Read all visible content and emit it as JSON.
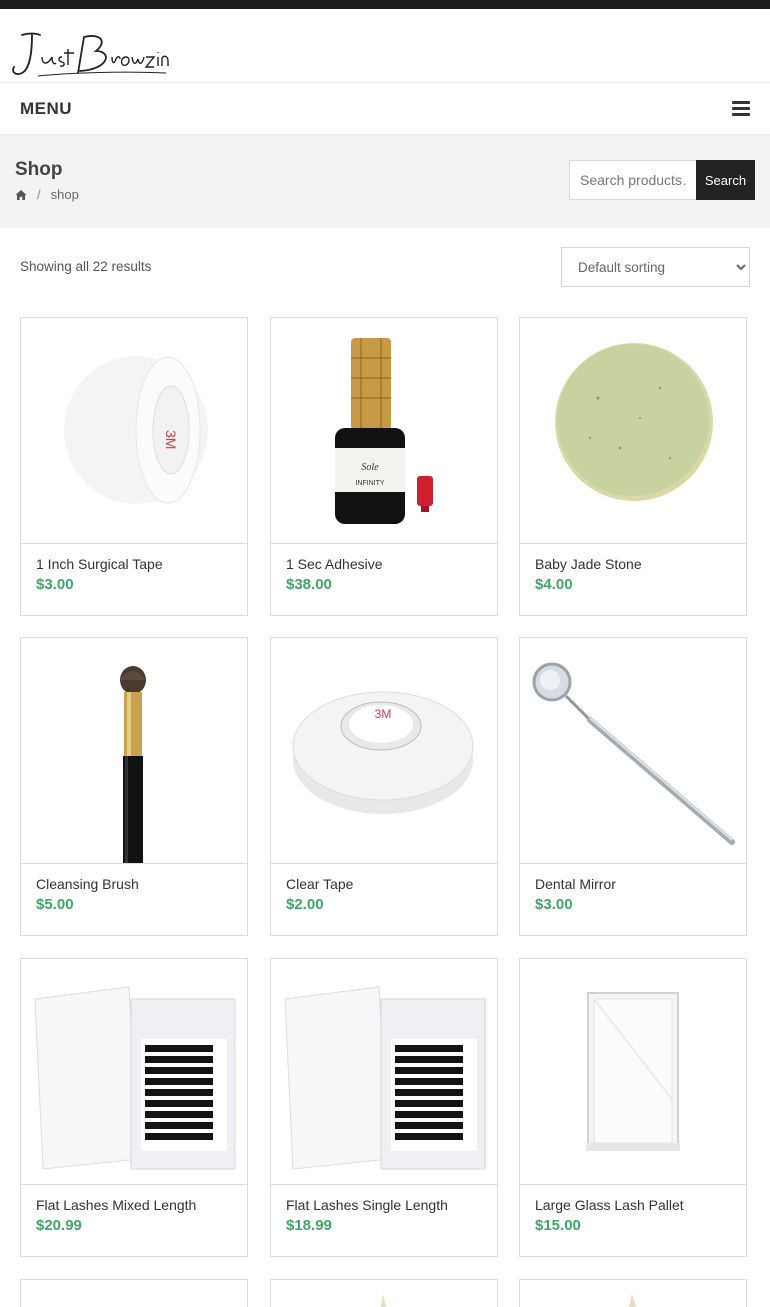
{
  "brand": {
    "logo_text": "Just Browzin"
  },
  "menu": {
    "label": "MENU"
  },
  "page": {
    "title": "Shop",
    "breadcrumb": [
      "shop"
    ]
  },
  "search": {
    "placeholder": "Search products…",
    "button_label": "Search"
  },
  "catalog": {
    "results_text": "Showing all 22 results",
    "sort_selected": "Default sorting",
    "products": [
      {
        "name": "1 Inch Surgical Tape",
        "price": "$3.00",
        "image": "surgical-tape-image"
      },
      {
        "name": "1 Sec Adhesive",
        "price": "$38.00",
        "image": "adhesive-bottle-image"
      },
      {
        "name": "Baby Jade Stone",
        "price": "$4.00",
        "image": "jade-stone-image"
      },
      {
        "name": "Cleansing Brush",
        "price": "$5.00",
        "image": "cleansing-brush-image"
      },
      {
        "name": "Clear Tape",
        "price": "$2.00",
        "image": "clear-tape-image"
      },
      {
        "name": "Dental Mirror",
        "price": "$3.00",
        "image": "dental-mirror-image"
      },
      {
        "name": "Flat Lashes Mixed Length",
        "price": "$20.99",
        "image": "lash-tray-image"
      },
      {
        "name": "Flat Lashes Single Length",
        "price": "$18.99",
        "image": "lash-tray-image"
      },
      {
        "name": "Large Glass Lash Pallet",
        "price": "$15.00",
        "image": "glass-pallet-image"
      }
    ]
  },
  "colors": {
    "price": "#3fa668",
    "topbar": "#1d1d1f",
    "search_button": "#222222"
  }
}
